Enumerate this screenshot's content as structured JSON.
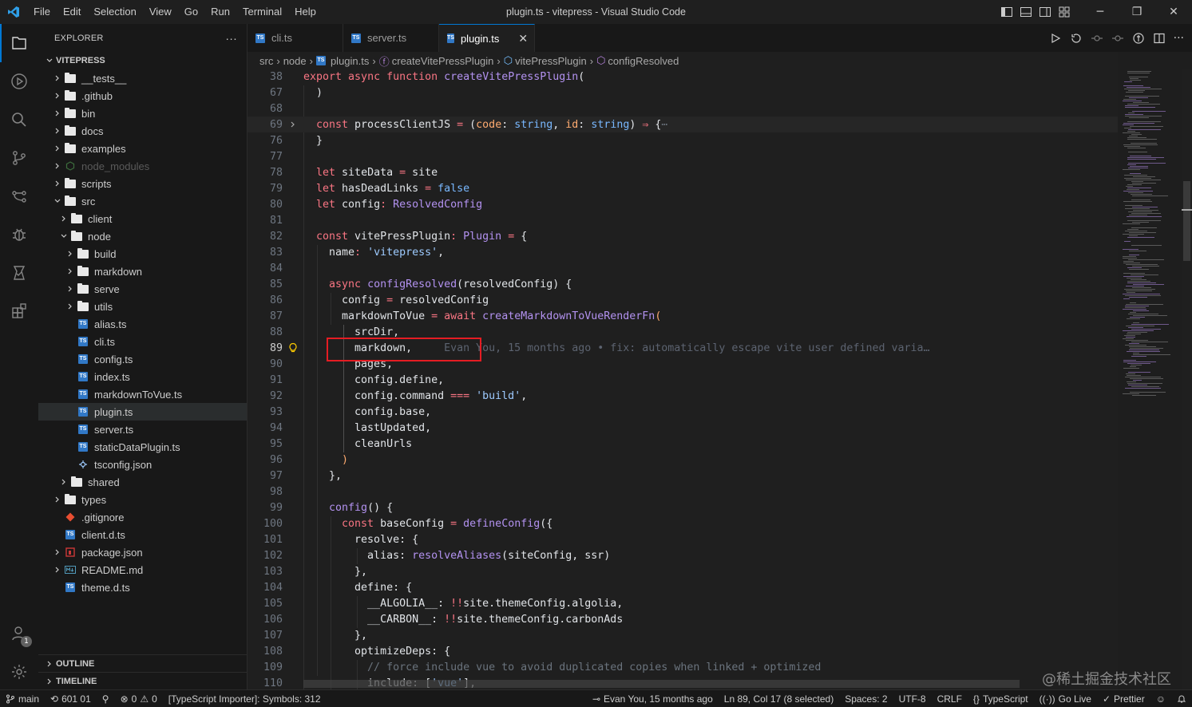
{
  "window": {
    "title": "plugin.ts - vitepress - Visual Studio Code"
  },
  "menu": [
    "File",
    "Edit",
    "Selection",
    "View",
    "Go",
    "Run",
    "Terminal",
    "Help"
  ],
  "sidebar": {
    "title": "EXPLORER",
    "more": "···",
    "root": "VITEPRESS",
    "items": [
      {
        "label": "__tests__",
        "type": "folder",
        "level": 0,
        "open": false
      },
      {
        "label": ".github",
        "type": "folder",
        "level": 0,
        "open": false
      },
      {
        "label": "bin",
        "type": "folder",
        "level": 0,
        "open": false
      },
      {
        "label": "docs",
        "type": "folder",
        "level": 0,
        "open": false
      },
      {
        "label": "examples",
        "type": "folder",
        "level": 0,
        "open": false
      },
      {
        "label": "node_modules",
        "type": "node",
        "level": 0,
        "open": false
      },
      {
        "label": "scripts",
        "type": "folder",
        "level": 0,
        "open": false
      },
      {
        "label": "src",
        "type": "folder",
        "level": 0,
        "open": true
      },
      {
        "label": "client",
        "type": "folder",
        "level": 1,
        "open": false
      },
      {
        "label": "node",
        "type": "folder",
        "level": 1,
        "open": true
      },
      {
        "label": "build",
        "type": "folder",
        "level": 2,
        "open": false
      },
      {
        "label": "markdown",
        "type": "folder",
        "level": 2,
        "open": false
      },
      {
        "label": "serve",
        "type": "folder",
        "level": 2,
        "open": false
      },
      {
        "label": "utils",
        "type": "folder",
        "level": 2,
        "open": false
      },
      {
        "label": "alias.ts",
        "type": "ts",
        "level": 2
      },
      {
        "label": "cli.ts",
        "type": "ts",
        "level": 2
      },
      {
        "label": "config.ts",
        "type": "ts",
        "level": 2
      },
      {
        "label": "index.ts",
        "type": "ts",
        "level": 2
      },
      {
        "label": "markdownToVue.ts",
        "type": "ts",
        "level": 2
      },
      {
        "label": "plugin.ts",
        "type": "ts",
        "level": 2,
        "selected": true
      },
      {
        "label": "server.ts",
        "type": "ts",
        "level": 2
      },
      {
        "label": "staticDataPlugin.ts",
        "type": "ts",
        "level": 2
      },
      {
        "label": "tsconfig.json",
        "type": "tsconfig",
        "level": 2
      },
      {
        "label": "shared",
        "type": "folder",
        "level": 1,
        "open": false
      },
      {
        "label": "types",
        "type": "folder",
        "level": 0,
        "open": false
      },
      {
        "label": ".gitignore",
        "type": "git",
        "level": 0
      },
      {
        "label": "client.d.ts",
        "type": "ts",
        "level": 0
      },
      {
        "label": "package.json",
        "type": "json",
        "level": 0,
        "open": false
      },
      {
        "label": "README.md",
        "type": "md",
        "level": 0,
        "open": false
      },
      {
        "label": "theme.d.ts",
        "type": "ts",
        "level": 0
      }
    ],
    "outline": "OUTLINE",
    "timeline": "TIMELINE"
  },
  "tabs": [
    {
      "label": "cli.ts",
      "active": false
    },
    {
      "label": "server.ts",
      "active": false
    },
    {
      "label": "plugin.ts",
      "active": true
    }
  ],
  "breadcrumb": [
    "src",
    "node",
    "plugin.ts",
    "createVitePressPlugin",
    "vitePressPlugin",
    "configResolved"
  ],
  "editor": {
    "blame": "Evan You, 15 months ago • fix: automatically escape vite user defined varia…",
    "lines": [
      {
        "n": "38",
        "code": [
          [
            "kw",
            "export "
          ],
          [
            "kw",
            "async "
          ],
          [
            "kw",
            "function "
          ],
          [
            "fn",
            "createVitePressPlugin"
          ],
          [
            "var",
            "("
          ]
        ]
      },
      {
        "n": "67",
        "code": [
          [
            "var",
            "  )"
          ]
        ]
      },
      {
        "n": "68",
        "code": [
          [
            "var",
            ""
          ]
        ]
      },
      {
        "n": "69",
        "fold": true,
        "hl": true,
        "code": [
          [
            "kw",
            "  const "
          ],
          [
            "var",
            "processClientJS "
          ],
          [
            "op",
            "= "
          ],
          [
            "var",
            "("
          ],
          [
            "prop",
            "code"
          ],
          [
            "var",
            ": "
          ],
          [
            "ty",
            "string"
          ],
          [
            "var",
            ", "
          ],
          [
            "prop",
            "id"
          ],
          [
            "var",
            ": "
          ],
          [
            "ty",
            "string"
          ],
          [
            "var",
            ") "
          ],
          [
            "op",
            "⇒ "
          ],
          [
            "var",
            "{"
          ],
          [
            "cm",
            "⋯"
          ]
        ]
      },
      {
        "n": "76",
        "code": [
          [
            "var",
            "  }"
          ]
        ]
      },
      {
        "n": "77",
        "code": [
          [
            "var",
            ""
          ]
        ]
      },
      {
        "n": "78",
        "code": [
          [
            "kw",
            "  let "
          ],
          [
            "var",
            "siteData "
          ],
          [
            "op",
            "= "
          ],
          [
            "var",
            "site"
          ]
        ]
      },
      {
        "n": "79",
        "code": [
          [
            "kw",
            "  let "
          ],
          [
            "var",
            "hasDeadLinks "
          ],
          [
            "op",
            "= "
          ],
          [
            "ty",
            "false"
          ]
        ]
      },
      {
        "n": "80",
        "code": [
          [
            "kw",
            "  let "
          ],
          [
            "var",
            "config"
          ],
          [
            "op",
            ": "
          ],
          [
            "fn",
            "ResolvedConfig"
          ]
        ]
      },
      {
        "n": "81",
        "code": [
          [
            "var",
            ""
          ]
        ]
      },
      {
        "n": "82",
        "code": [
          [
            "kw",
            "  const "
          ],
          [
            "var",
            "vitePressPlugin"
          ],
          [
            "op",
            ": "
          ],
          [
            "fn",
            "Plugin "
          ],
          [
            "op",
            "= "
          ],
          [
            "var",
            "{"
          ]
        ]
      },
      {
        "n": "83",
        "code": [
          [
            "var",
            "    name"
          ],
          [
            "op",
            ": "
          ],
          [
            "str",
            "'vitepress'"
          ],
          [
            "var",
            ","
          ]
        ]
      },
      {
        "n": "84",
        "code": [
          [
            "var",
            ""
          ]
        ]
      },
      {
        "n": "85",
        "code": [
          [
            "kw",
            "    async "
          ],
          [
            "fn",
            "configResolved"
          ],
          [
            "var",
            "(resolvedConfig) {"
          ]
        ]
      },
      {
        "n": "86",
        "code": [
          [
            "var",
            "      config "
          ],
          [
            "op",
            "= "
          ],
          [
            "var",
            "resolvedConfig"
          ]
        ]
      },
      {
        "n": "87",
        "code": [
          [
            "var",
            "      markdownToVue "
          ],
          [
            "op",
            "= "
          ],
          [
            "kw",
            "await "
          ],
          [
            "fn",
            "createMarkdownToVueRenderFn"
          ],
          [
            "prop",
            "("
          ]
        ]
      },
      {
        "n": "88",
        "code": [
          [
            "var",
            "        srcDir,"
          ]
        ]
      },
      {
        "n": "89",
        "current": true,
        "bulb": true,
        "code": [
          [
            "var",
            "        markdown,"
          ]
        ],
        "blame": true
      },
      {
        "n": "90",
        "code": [
          [
            "var",
            "        pages,"
          ]
        ]
      },
      {
        "n": "91",
        "code": [
          [
            "var",
            "        config.define,"
          ]
        ]
      },
      {
        "n": "92",
        "code": [
          [
            "var",
            "        config.command "
          ],
          [
            "op",
            "=== "
          ],
          [
            "str",
            "'build'"
          ],
          [
            "var",
            ","
          ]
        ]
      },
      {
        "n": "93",
        "code": [
          [
            "var",
            "        config.base,"
          ]
        ]
      },
      {
        "n": "94",
        "code": [
          [
            "var",
            "        lastUpdated,"
          ]
        ]
      },
      {
        "n": "95",
        "code": [
          [
            "var",
            "        cleanUrls"
          ]
        ]
      },
      {
        "n": "96",
        "code": [
          [
            "prop",
            "      )"
          ]
        ]
      },
      {
        "n": "97",
        "code": [
          [
            "var",
            "    },"
          ]
        ]
      },
      {
        "n": "98",
        "code": [
          [
            "var",
            ""
          ]
        ]
      },
      {
        "n": "99",
        "code": [
          [
            "fn",
            "    config"
          ],
          [
            "var",
            "() {"
          ]
        ]
      },
      {
        "n": "100",
        "code": [
          [
            "kw",
            "      const "
          ],
          [
            "var",
            "baseConfig "
          ],
          [
            "op",
            "= "
          ],
          [
            "fn",
            "defineConfig"
          ],
          [
            "var",
            "({"
          ]
        ]
      },
      {
        "n": "101",
        "code": [
          [
            "var",
            "        resolve: {"
          ]
        ]
      },
      {
        "n": "102",
        "code": [
          [
            "var",
            "          alias: "
          ],
          [
            "fn",
            "resolveAliases"
          ],
          [
            "var",
            "(siteConfig, ssr)"
          ]
        ]
      },
      {
        "n": "103",
        "code": [
          [
            "var",
            "        },"
          ]
        ]
      },
      {
        "n": "104",
        "code": [
          [
            "var",
            "        define: {"
          ]
        ]
      },
      {
        "n": "105",
        "code": [
          [
            "var",
            "          __ALGOLIA__: "
          ],
          [
            "op",
            "!!"
          ],
          [
            "var",
            "site.themeConfig.algolia,"
          ]
        ]
      },
      {
        "n": "106",
        "code": [
          [
            "var",
            "          __CARBON__: "
          ],
          [
            "op",
            "!!"
          ],
          [
            "var",
            "site.themeConfig.carbonAds"
          ]
        ]
      },
      {
        "n": "107",
        "code": [
          [
            "var",
            "        },"
          ]
        ]
      },
      {
        "n": "108",
        "code": [
          [
            "var",
            "        optimizeDeps: {"
          ]
        ]
      },
      {
        "n": "109",
        "code": [
          [
            "cm",
            "          // force include vue to avoid duplicated copies when linked + optimized"
          ]
        ]
      },
      {
        "n": "110",
        "code": [
          [
            "var",
            "          include: ["
          ],
          [
            "str",
            "'vue'"
          ],
          [
            "var",
            "],"
          ]
        ]
      }
    ]
  },
  "status": {
    "branch": "main",
    "sync": "601 01",
    "problems_errors": "0",
    "problems_warnings": "0",
    "importer": "[TypeScript Importer]: Symbols: 312",
    "blame": "Evan You, 15 months ago",
    "position": "Ln 89, Col 17 (8 selected)",
    "spaces": "Spaces: 2",
    "encoding": "UTF-8",
    "eol": "CRLF",
    "language": "TypeScript",
    "golive": "Go Live",
    "prettier": "Prettier"
  },
  "watermark": "@稀土掘金技术社区",
  "accounts_badge": "1"
}
